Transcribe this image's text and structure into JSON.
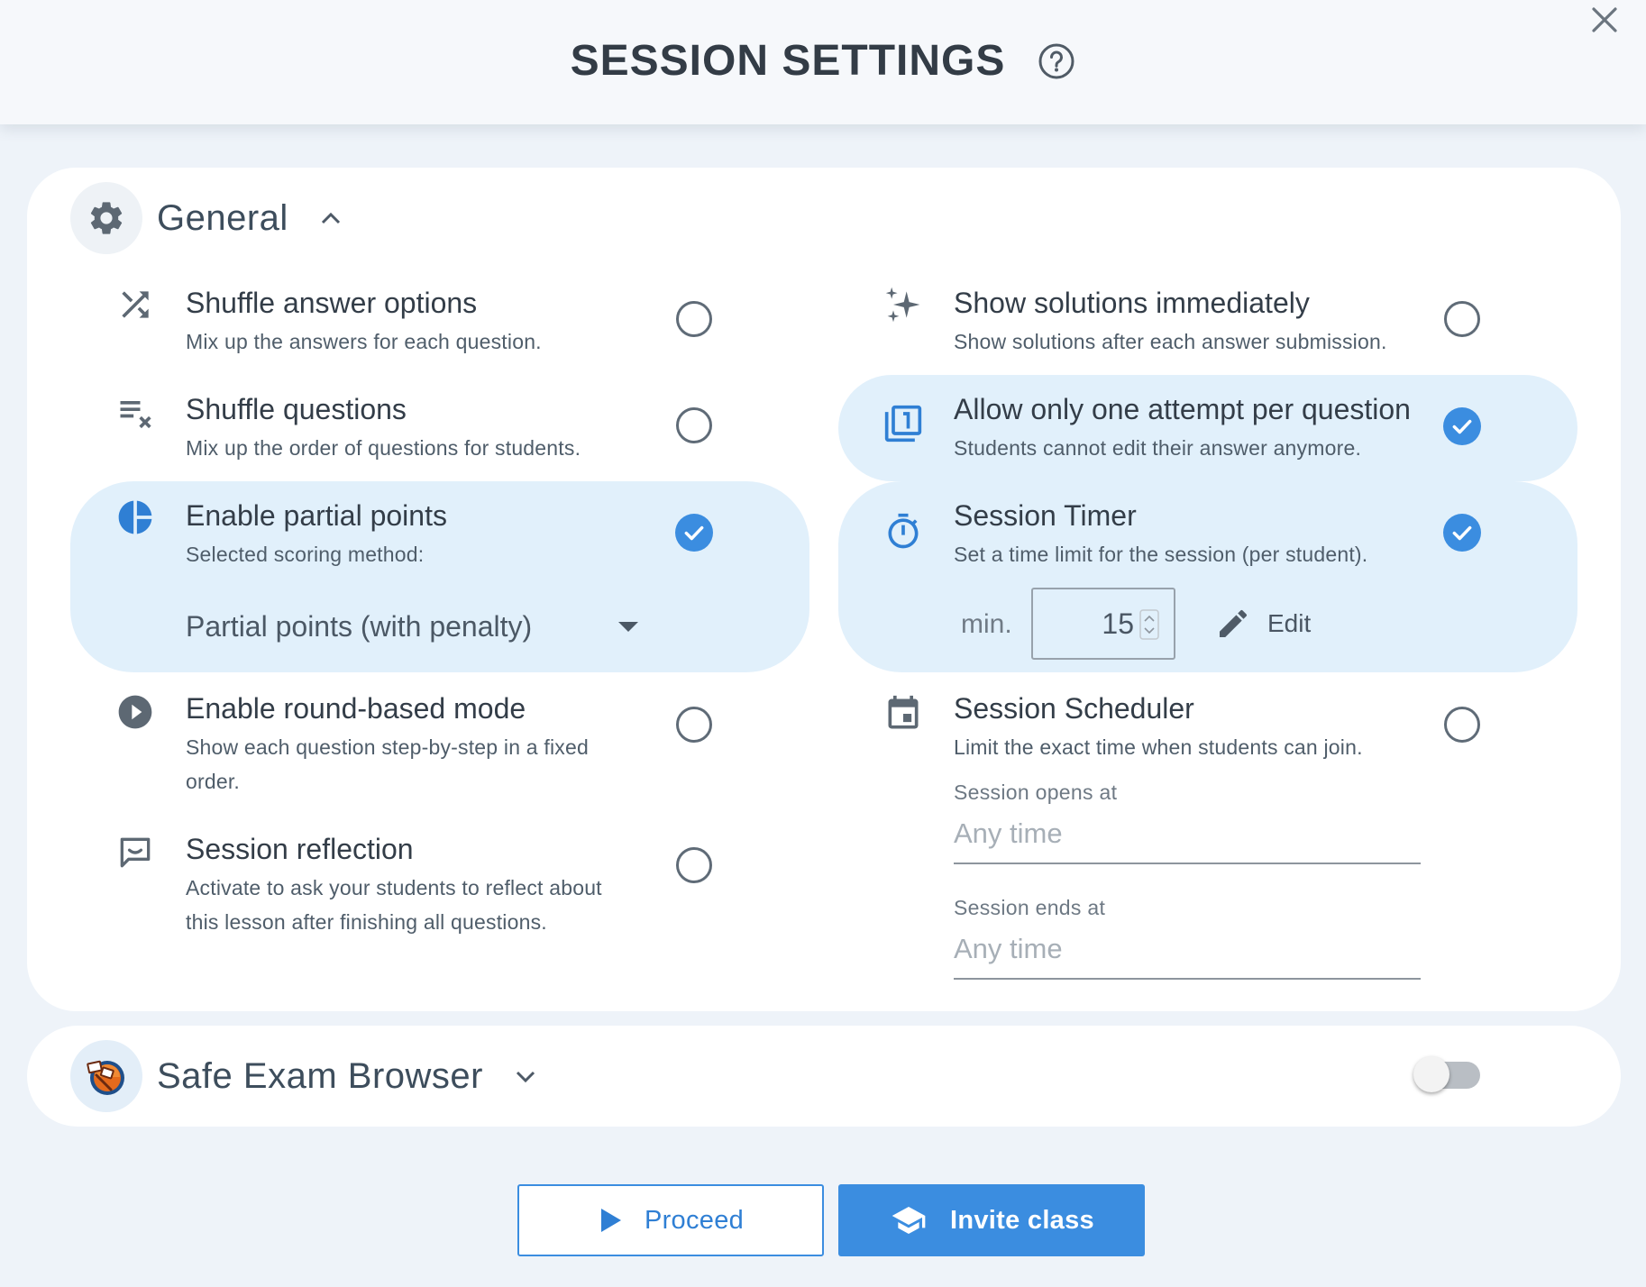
{
  "header": {
    "title": "SESSION SETTINGS",
    "help_icon": "help-circle-icon",
    "close_icon": "close-icon"
  },
  "general": {
    "title": "General",
    "icon": "gear-icon",
    "expanded": true,
    "options": {
      "shuffle_answers": {
        "label": "Shuffle answer options",
        "desc": "Mix up the answers for each question.",
        "checked": false,
        "icon": "shuffle-icon"
      },
      "shuffle_questions": {
        "label": "Shuffle questions",
        "desc": "Mix up the order of questions for students.",
        "checked": false,
        "icon": "playlist-remove-icon"
      },
      "partial_points": {
        "label": "Enable partial points",
        "desc": "Selected scoring method:",
        "checked": true,
        "icon": "pie-chart-icon",
        "method": "Partial points (with penalty)"
      },
      "round_mode": {
        "label": "Enable round-based mode",
        "desc_line1": "Show each question step-by-step in a fixed",
        "desc_line2": "order.",
        "checked": false,
        "icon": "play-circle-icon"
      },
      "reflection": {
        "label": "Session reflection",
        "desc_line1": "Activate to ask your students to reflect about",
        "desc_line2": "this lesson after finishing all questions.",
        "checked": false,
        "icon": "comment-icon"
      },
      "show_solutions": {
        "label": "Show solutions immediately",
        "desc": "Show solutions after each answer submission.",
        "checked": false,
        "icon": "sparkles-icon"
      },
      "one_attempt": {
        "label": "Allow only one attempt per question",
        "desc": "Students cannot edit their answer anymore.",
        "checked": true,
        "icon": "filter-1-icon"
      },
      "timer": {
        "label": "Session Timer",
        "desc": "Set a time limit for the session (per student).",
        "checked": true,
        "icon": "timer-icon",
        "unit": "min.",
        "value": "15",
        "edit_label": "Edit"
      },
      "scheduler": {
        "label": "Session Scheduler",
        "desc": "Limit the exact time when students can join.",
        "checked": false,
        "icon": "calendar-icon",
        "opens_label": "Session opens at",
        "opens_value": "Any time",
        "ends_label": "Session ends at",
        "ends_value": "Any time"
      }
    }
  },
  "seb": {
    "title": "Safe Exam Browser",
    "icon": "safe-exam-browser-logo",
    "enabled": false
  },
  "footer": {
    "proceed_label": "Proceed",
    "invite_label": "Invite class"
  },
  "colors": {
    "accent": "#3b8de0",
    "highlight": "#e1f0fb",
    "background": "#eef3f9"
  }
}
